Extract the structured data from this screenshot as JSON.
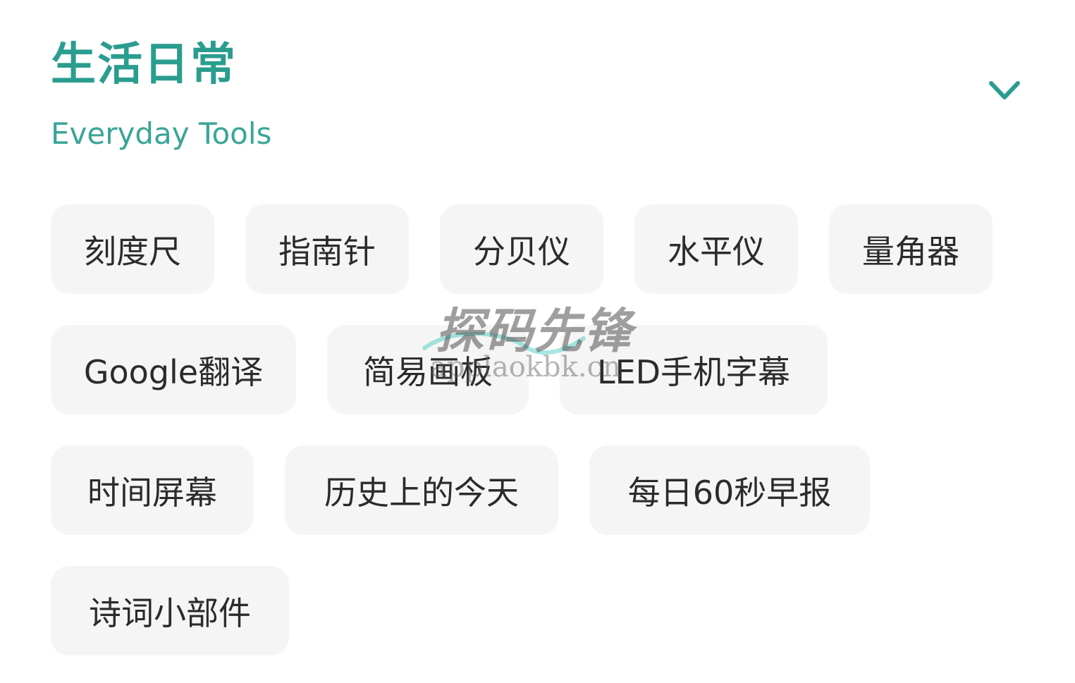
{
  "section": {
    "title": "生活日常",
    "subtitle": "Everyday Tools",
    "toggle_icon": "chevron-down-icon",
    "accent_color": "#2a9d8f"
  },
  "tools": [
    [
      "刻度尺",
      "指南针",
      "分贝仪",
      "水平仪",
      "量角器"
    ],
    [
      "Google翻译",
      "简易画板",
      "LED手机字幕"
    ],
    [
      "时间屏幕",
      "历史上的今天",
      "每日60秒早报"
    ],
    [
      "诗词小部件"
    ]
  ],
  "watermark": {
    "title": "探码先锋",
    "url": "applaokbk.cn"
  }
}
